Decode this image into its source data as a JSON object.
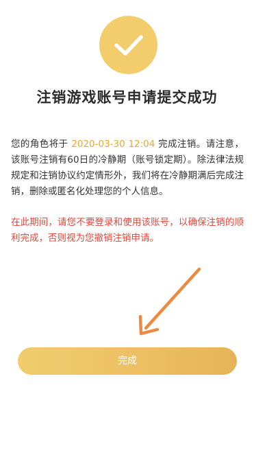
{
  "result": {
    "title": "注销游戏账号申请提交成功",
    "icon": "checkmark-icon",
    "accent_color": "#f3cd6b"
  },
  "notice": {
    "part1": "您的角色将于 ",
    "date": "2020-03-30 12:04",
    "part2": " 完成注销。请注意，该账号注销有60日的冷静期（账号锁定期）。除法律法规规定和注销协议约定情形外，我们将在冷静期满后完成注销，删除或匿名化处理您的个人信息。",
    "date_color": "#e4a92f"
  },
  "warning": {
    "text": "在此期间，请您不要登录和使用该账号，以确保注销的顺利完成，否则视为您撤销注销申请。",
    "color": "#e0493d"
  },
  "actions": {
    "done_label": "完成"
  }
}
